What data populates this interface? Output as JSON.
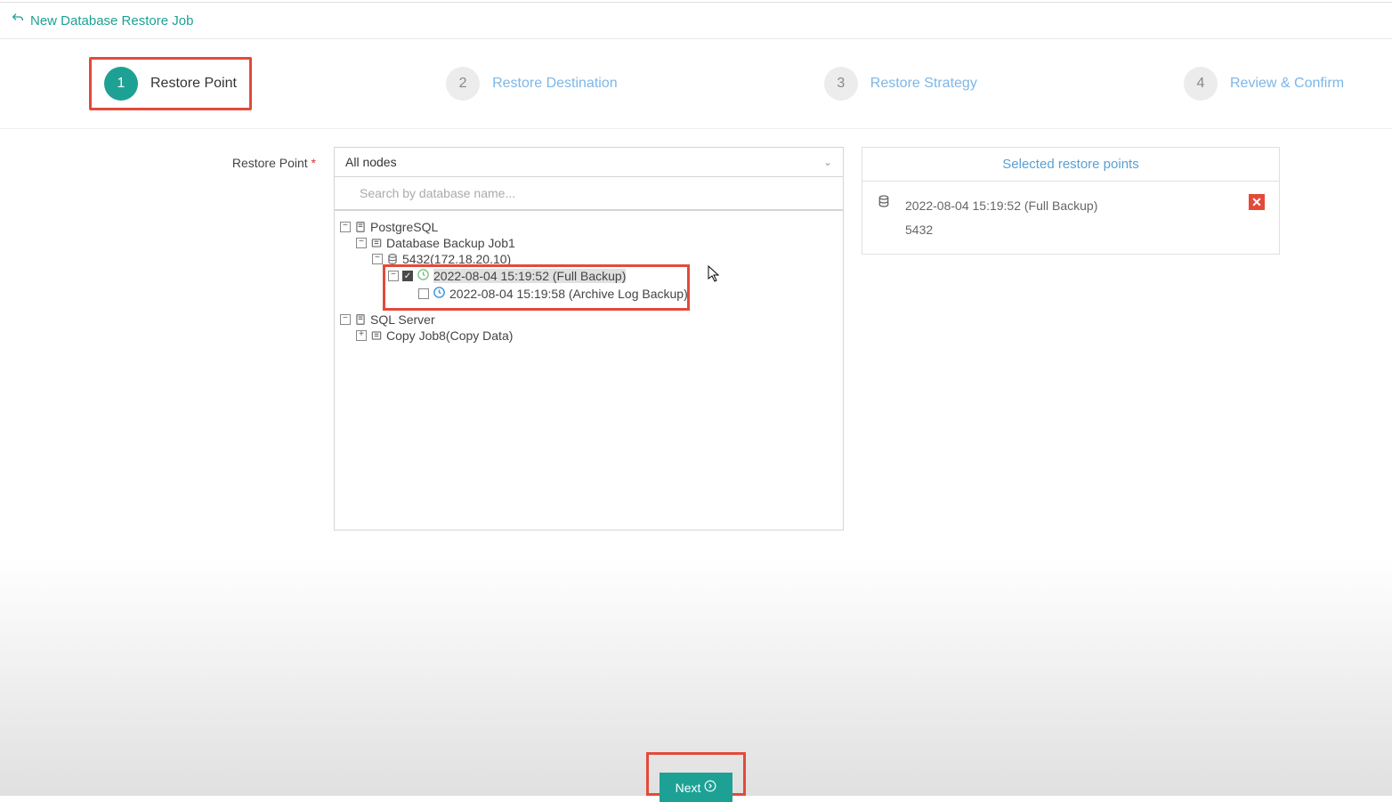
{
  "header": {
    "title": "New Database Restore Job"
  },
  "steps": {
    "s1": {
      "num": "1",
      "label": "Restore Point"
    },
    "s2": {
      "num": "2",
      "label": "Restore Destination"
    },
    "s3": {
      "num": "3",
      "label": "Restore Strategy"
    },
    "s4": {
      "num": "4",
      "label": "Review & Confirm"
    }
  },
  "form": {
    "restore_point_label": "Restore Point",
    "filter_value": "All nodes",
    "search_placeholder": "Search by database name..."
  },
  "tree": {
    "postgresql": "PostgreSQL",
    "job1": "Database Backup Job1",
    "instance": "5432(172.18.20.10)",
    "full_backup": "2022-08-04 15:19:52 (Full Backup)",
    "log_backup": "2022-08-04 15:19:58 (Archive Log Backup)",
    "sqlserver": "SQL Server",
    "copyjob": "Copy Job8(Copy Data)"
  },
  "right_panel": {
    "title": "Selected restore points",
    "item_title": "2022-08-04 15:19:52 (Full Backup)",
    "item_sub": "5432"
  },
  "footer": {
    "next": "Next"
  }
}
